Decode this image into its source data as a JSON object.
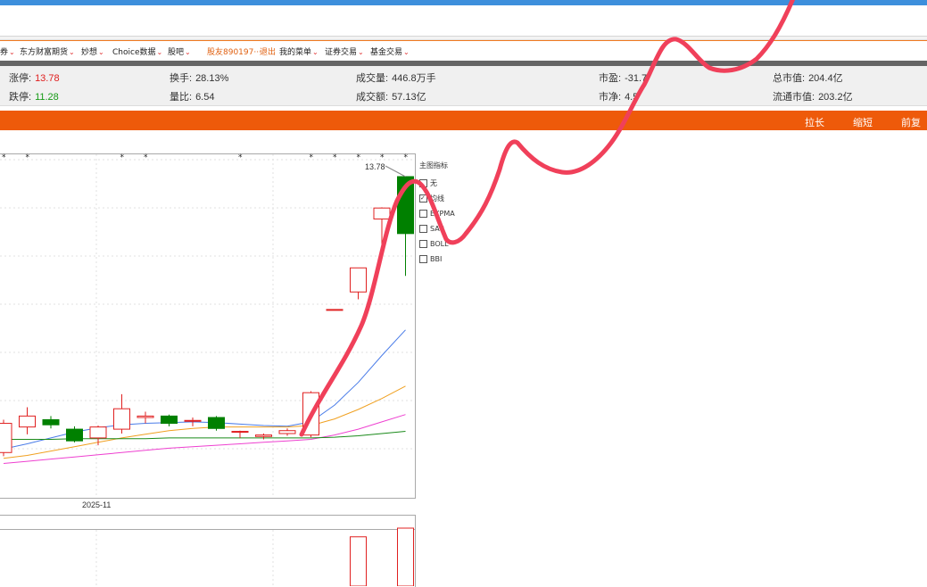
{
  "menu": {
    "items": [
      {
        "label": "券",
        "chevron": true,
        "orange": false
      },
      {
        "label": "东方财富期货",
        "chevron": true,
        "orange": false
      },
      {
        "label": "妙想",
        "chevron": true,
        "orange": false
      },
      {
        "label": "Choice数据",
        "chevron": true,
        "orange": false
      },
      {
        "label": "股吧",
        "chevron": true,
        "orange": false
      },
      {
        "label": "股友890197···",
        "chevron": false,
        "orange": true
      },
      {
        "label": "退出",
        "chevron": false,
        "orange": true
      },
      {
        "label": "我的菜单",
        "chevron": true,
        "orange": false
      },
      {
        "label": "证券交易",
        "chevron": true,
        "orange": false
      },
      {
        "label": "基金交易",
        "chevron": true,
        "orange": false
      }
    ]
  },
  "quotes": {
    "limit_up": {
      "label": "涨停:",
      "value": "13.78"
    },
    "limit_down": {
      "label": "跌停:",
      "value": "11.28"
    },
    "turnover": {
      "label": "换手:",
      "value": "28.13%"
    },
    "volume_ratio": {
      "label": "量比:",
      "value": "6.54"
    },
    "volume": {
      "label": "成交量:",
      "value": "446.8万手"
    },
    "amount": {
      "label": "成交额:",
      "value": "57.13亿"
    },
    "pe": {
      "label": "市盈:",
      "value": "-31.7"
    },
    "pb": {
      "label": "市净:",
      "value": "4.5"
    },
    "market_cap": {
      "label": "总市值:",
      "value": "204.4亿"
    },
    "float_cap": {
      "label": "流通市值:",
      "value": "203.2亿"
    }
  },
  "toolbar": {
    "stretch_label": "拉长",
    "shrink_label": "缩短",
    "adjust_label": "前复权"
  },
  "chart": {
    "max_label": "13.78",
    "date_label": "2025-11"
  },
  "indicators": {
    "title": "主图指标",
    "options": [
      "无",
      "均线",
      "EXPMA",
      "SAR",
      "BOLL",
      "BBI"
    ],
    "checked": [
      false,
      true,
      false,
      false,
      false,
      false
    ]
  },
  "colors": {
    "accent_orange": "#ee5a0a",
    "up_red": "#e02020",
    "down_green": "#008000",
    "annotation_red": "#f0405a",
    "top_blue": "#3d8fdc"
  },
  "chart_data": {
    "type": "candlestick",
    "title": "",
    "xlabel": "",
    "ylabel": "",
    "x_ticks": [
      "2025-11"
    ],
    "candles": [
      {
        "open": 10.4,
        "close": 10.0,
        "high": 10.45,
        "low": 9.95,
        "dir": "up"
      },
      {
        "open": 10.35,
        "close": 10.5,
        "high": 10.62,
        "low": 10.25,
        "dir": "up"
      },
      {
        "open": 10.45,
        "close": 10.38,
        "high": 10.5,
        "low": 10.33,
        "dir": "down"
      },
      {
        "open": 10.32,
        "close": 10.16,
        "high": 10.36,
        "low": 10.14,
        "dir": "down"
      },
      {
        "open": 10.2,
        "close": 10.35,
        "high": 10.37,
        "low": 10.1,
        "dir": "up"
      },
      {
        "open": 10.32,
        "close": 10.6,
        "high": 10.8,
        "low": 10.26,
        "dir": "up"
      },
      {
        "open": 10.48,
        "close": 10.5,
        "high": 10.56,
        "low": 10.4,
        "dir": "up"
      },
      {
        "open": 10.5,
        "close": 10.4,
        "high": 10.52,
        "low": 10.36,
        "dir": "down"
      },
      {
        "open": 10.44,
        "close": 10.43,
        "high": 10.48,
        "low": 10.36,
        "dir": "up"
      },
      {
        "open": 10.48,
        "close": 10.33,
        "high": 10.5,
        "low": 10.3,
        "dir": "down"
      },
      {
        "open": 10.28,
        "close": 10.29,
        "high": 10.3,
        "low": 10.2,
        "dir": "up"
      },
      {
        "open": 10.22,
        "close": 10.24,
        "high": 10.26,
        "low": 10.18,
        "dir": "up"
      },
      {
        "open": 10.26,
        "close": 10.3,
        "high": 10.33,
        "low": 10.23,
        "dir": "up"
      },
      {
        "open": 10.24,
        "close": 10.82,
        "high": 10.84,
        "low": 10.21,
        "dir": "up"
      },
      {
        "open": 11.95,
        "close": 11.96,
        "high": 11.96,
        "low": 11.95,
        "dir": "up"
      },
      {
        "open": 12.2,
        "close": 12.53,
        "high": 12.53,
        "low": 12.1,
        "dir": "up"
      },
      {
        "open": 13.2,
        "close": 13.35,
        "high": 13.36,
        "low": 12.8,
        "dir": "up"
      },
      {
        "open": 13.78,
        "close": 13.0,
        "high": 13.78,
        "low": 12.42,
        "dir": "down"
      }
    ],
    "series": [
      {
        "color": "#4a7ce8",
        "values": [
          10.05,
          10.12,
          10.2,
          10.28,
          10.34,
          10.38,
          10.4,
          10.41,
          10.42,
          10.41,
          10.39,
          10.37,
          10.36,
          10.42,
          10.65,
          10.96,
          11.33,
          11.68
        ]
      },
      {
        "color": "#f0a020",
        "values": [
          9.92,
          9.96,
          10.02,
          10.08,
          10.14,
          10.2,
          10.25,
          10.3,
          10.33,
          10.35,
          10.35,
          10.35,
          10.35,
          10.37,
          10.46,
          10.59,
          10.74,
          10.91
        ]
      },
      {
        "color": "#ee40d0",
        "values": [
          9.85,
          9.88,
          9.91,
          9.94,
          9.97,
          10.0,
          10.03,
          10.06,
          10.08,
          10.1,
          10.12,
          10.14,
          10.16,
          10.18,
          10.24,
          10.32,
          10.42,
          10.52
        ]
      },
      {
        "color": "#1a8a1a",
        "values": [
          10.18,
          10.18,
          10.18,
          10.19,
          10.19,
          10.19,
          10.19,
          10.2,
          10.2,
          10.2,
          10.2,
          10.2,
          10.2,
          10.2,
          10.21,
          10.23,
          10.26,
          10.29
        ]
      }
    ],
    "volume": [
      {
        "value": 0,
        "dir": "up"
      },
      {
        "value": 0,
        "dir": "up"
      },
      {
        "value": 0,
        "dir": "up"
      },
      {
        "value": 0,
        "dir": "up"
      },
      {
        "value": 0,
        "dir": "up"
      },
      {
        "value": 0,
        "dir": "up"
      },
      {
        "value": 0,
        "dir": "up"
      },
      {
        "value": 0,
        "dir": "up"
      },
      {
        "value": 0,
        "dir": "up"
      },
      {
        "value": 0,
        "dir": "up"
      },
      {
        "value": 0,
        "dir": "up"
      },
      {
        "value": 0,
        "dir": "up"
      },
      {
        "value": 0,
        "dir": "up"
      },
      {
        "value": 0,
        "dir": "up"
      },
      {
        "value": 0,
        "dir": "up"
      },
      {
        "value": 0.85,
        "dir": "up"
      },
      {
        "value": 0,
        "dir": "up"
      },
      {
        "value": 1.0,
        "dir": "up"
      }
    ],
    "markers": [
      0,
      1,
      5,
      6,
      10,
      13,
      14,
      15,
      16,
      17
    ],
    "ylim": [
      9.6,
      14.0
    ],
    "grid": true
  }
}
